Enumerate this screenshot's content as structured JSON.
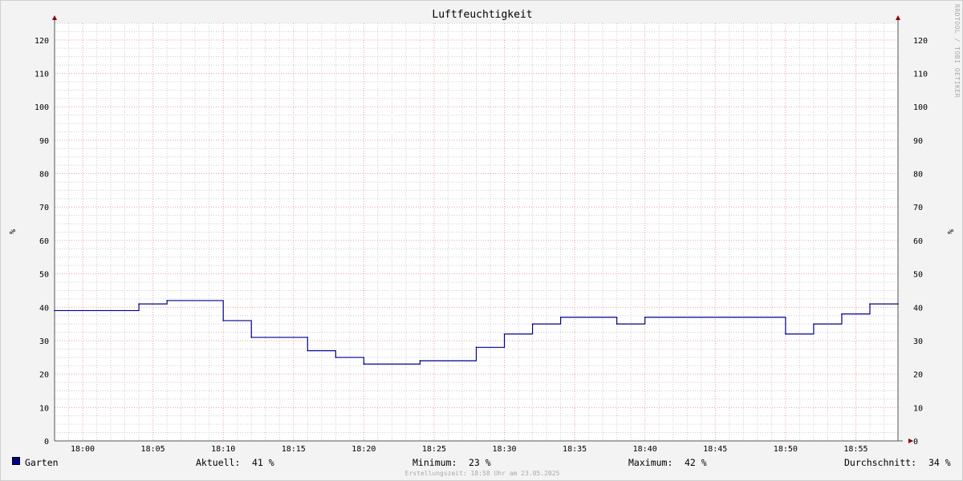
{
  "chart_data": {
    "type": "line",
    "title": "Luftfeuchtigkeit",
    "ylabel": "%",
    "ylabel_right": "%",
    "ylim": [
      0,
      125
    ],
    "yticks": [
      0,
      10,
      20,
      30,
      40,
      50,
      60,
      70,
      80,
      90,
      100,
      110,
      120
    ],
    "xlim_minutes": [
      1078,
      1138
    ],
    "x_tick_labels": [
      "18:00",
      "18:05",
      "18:10",
      "18:15",
      "18:20",
      "18:25",
      "18:30",
      "18:35",
      "18:40",
      "18:45",
      "18:50",
      "18:55"
    ],
    "x_tick_minutes": [
      1080,
      1085,
      1090,
      1095,
      1100,
      1105,
      1110,
      1115,
      1120,
      1125,
      1130,
      1135
    ],
    "series": [
      {
        "name": "Garten",
        "color": "#00008b",
        "step": true,
        "x": [
          "17:58",
          "18:04",
          "18:06",
          "18:10",
          "18:12",
          "18:16",
          "18:18",
          "18:20",
          "18:24",
          "18:28",
          "18:30",
          "18:32",
          "18:34",
          "18:38",
          "18:40",
          "18:50",
          "18:52",
          "18:54",
          "18:56",
          "18:58"
        ],
        "values": [
          39,
          41,
          42,
          36,
          31,
          27,
          25,
          23,
          24,
          28,
          32,
          35,
          37,
          35,
          37,
          32,
          35,
          38,
          41,
          41
        ]
      }
    ],
    "grid": true,
    "legend": "bottom"
  },
  "legend": {
    "series_name": "Garten",
    "current_label": "Aktuell:",
    "current_value": "41 %",
    "min_label": "Minimum:",
    "min_value": "23 %",
    "max_label": "Maximum:",
    "max_value": "42 %",
    "avg_label": "Durchschnitt:",
    "avg_value": "34 %"
  },
  "watermark": "RRDTOOL / TOBI OETIKER",
  "footer": "Erstellungszeit: 18:58 Uhr am 23.05.2025",
  "colors": {
    "line": "#00008b",
    "major_grid": "#e8a0a0",
    "minor_grid": "#cccccc",
    "axis": "#555555",
    "arrow": "#8b0000"
  }
}
